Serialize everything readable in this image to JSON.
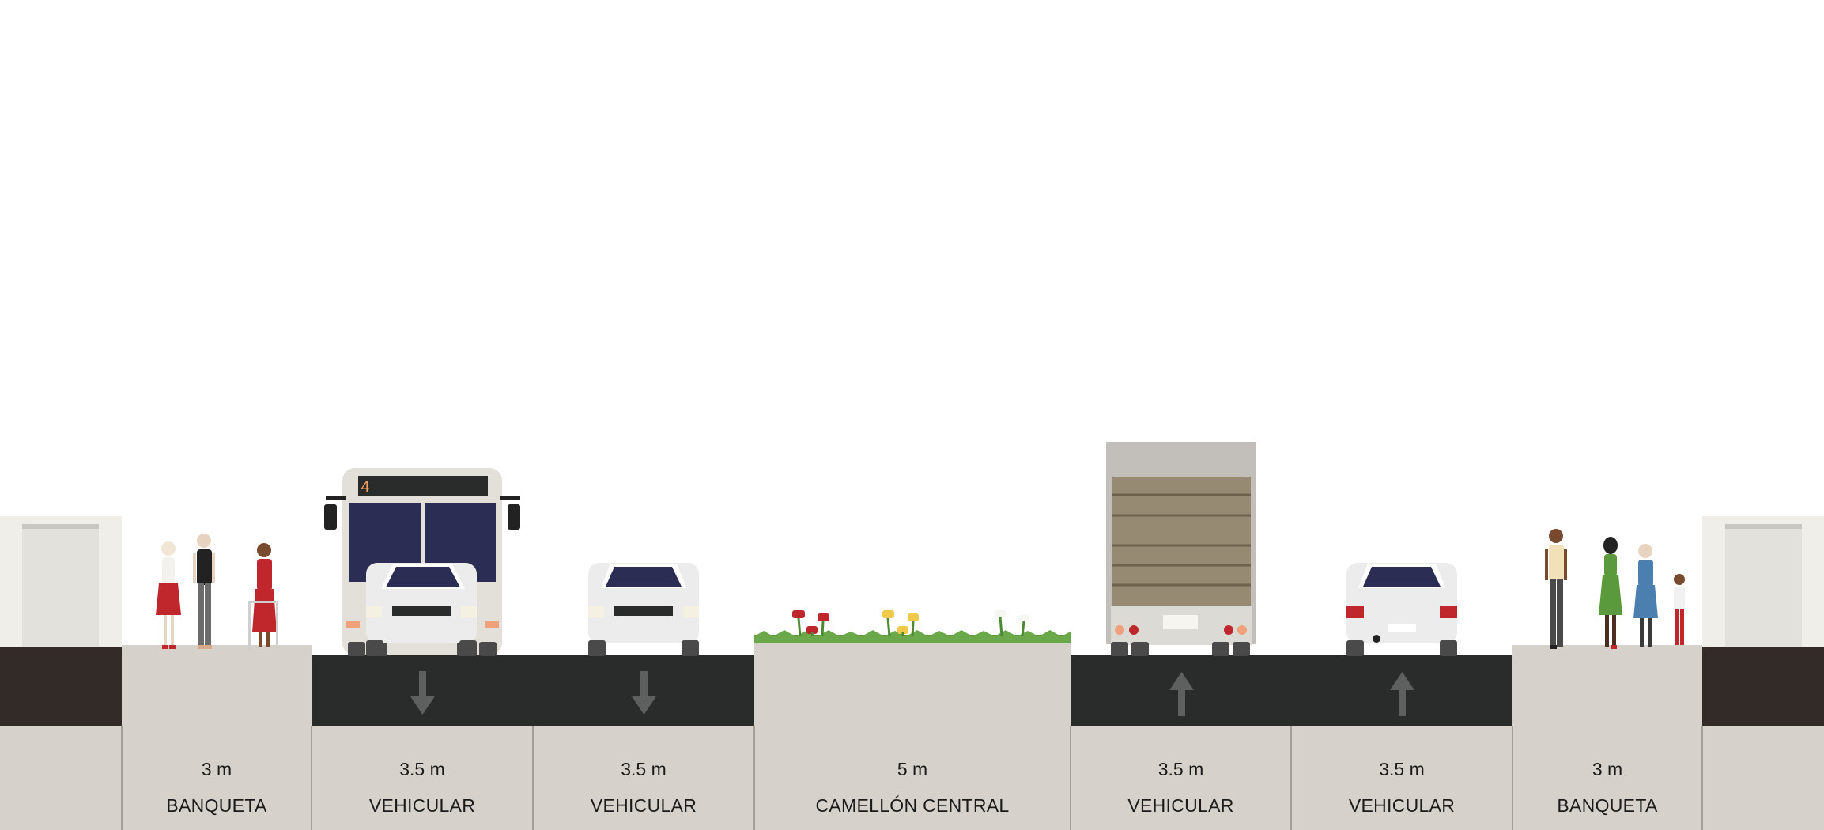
{
  "segments": [
    {
      "width": "3 m",
      "name": "BANQUETA"
    },
    {
      "width": "3.5 m",
      "name": "VEHICULAR"
    },
    {
      "width": "3.5 m",
      "name": "VEHICULAR"
    },
    {
      "width": "5 m",
      "name": "CAMELLÓN CENTRAL"
    },
    {
      "width": "3.5 m",
      "name": "VEHICULAR"
    },
    {
      "width": "3.5 m",
      "name": "VEHICULAR"
    },
    {
      "width": "3 m",
      "name": "BANQUETA"
    }
  ],
  "bus_route_number": "4",
  "colors": {
    "ground": "#d6d2cb",
    "asphalt": "#2a2c2b",
    "building_wall": "#332b27",
    "building_facade": "#efeee9",
    "divider": "#a39e96",
    "arrow": "#5e605f",
    "planter_grass": "#5a9a3c"
  },
  "icons": {
    "lane_arrow_down": "arrow-down-icon",
    "lane_arrow_up": "arrow-up-icon"
  }
}
